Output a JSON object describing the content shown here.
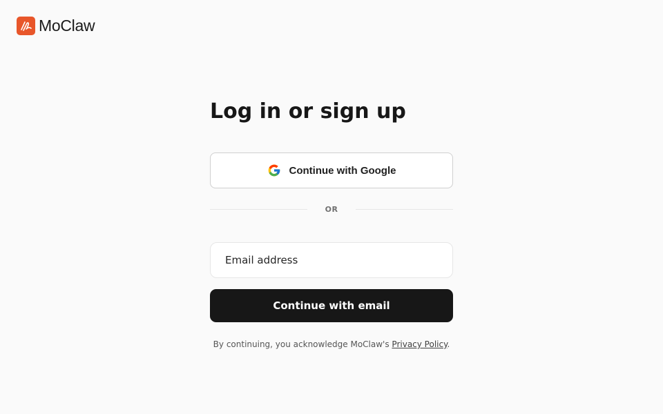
{
  "header": {
    "brand": "MoClaw",
    "logo_icon": "moclaw-logo-icon",
    "accent_color": "#e8562a"
  },
  "auth": {
    "title": "Log in or sign up",
    "google_button_label": "Continue with Google",
    "google_icon": "google-icon",
    "divider_text": "OR",
    "email_placeholder": "Email address",
    "email_value": "",
    "email_button_label": "Continue with email",
    "legal_prefix": "By continuing, you acknowledge MoClaw's ",
    "privacy_link": "Privacy Policy",
    "legal_suffix": "."
  }
}
